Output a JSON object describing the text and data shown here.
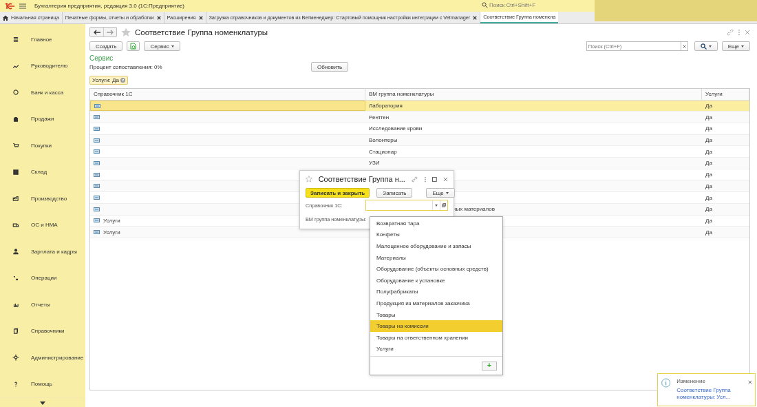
{
  "top_bar": {
    "title": "Бухгалтерия предприятия, редакция 3.0  (1С:Предприятие)",
    "search_placeholder": "Поиск Ctrl+Shift+F"
  },
  "tabs": [
    {
      "label": "Начальная страница",
      "kind": "home",
      "closable": false,
      "selected": false
    },
    {
      "label": "Печатные формы, отчеты и обработки",
      "kind": "tab",
      "closable": true,
      "selected": false
    },
    {
      "label": "Расширения",
      "kind": "tab",
      "closable": true,
      "selected": false
    },
    {
      "label": "Загрузка справочников и документов из Ветменеджер: Стартовый помощник настройки интеграции с Vetmanager",
      "kind": "tab",
      "closable": true,
      "selected": false
    },
    {
      "label": "Соответствие Группа номенкла",
      "kind": "tab",
      "closable": false,
      "selected": true
    }
  ],
  "sidebar": {
    "items": [
      {
        "label": "Главное"
      },
      {
        "label": "Руководителю"
      },
      {
        "label": "Банк и касса"
      },
      {
        "label": "Продажи"
      },
      {
        "label": "Покупки"
      },
      {
        "label": "Склад"
      },
      {
        "label": "Производство"
      },
      {
        "label": "ОС и НМА"
      },
      {
        "label": "Зарплата и кадры"
      },
      {
        "label": "Операции"
      },
      {
        "label": "Отчеты"
      },
      {
        "label": "Справочники"
      },
      {
        "label": "Администрирование"
      },
      {
        "label": "Помощь"
      }
    ]
  },
  "page": {
    "title": "Соответствие Группа номенклатуры",
    "create_button": "Создать",
    "service_button": "Сервис",
    "search_placeholder": "Поиск (Ctrl+F)",
    "more_button": "Еще",
    "section_title": "Сервис",
    "progress_label": "Процент сопоставления:  0%",
    "refresh_button": "Обновить",
    "filter_chip": "Услуги: Да"
  },
  "table": {
    "columns": [
      "Справочник 1С",
      "ВМ группа номенклатуры",
      "Услуги"
    ],
    "rows": [
      {
        "ref_1c": "",
        "vm_group": "Лаборатория",
        "services": "Да",
        "selected": true,
        "kind": "plain"
      },
      {
        "ref_1c": "",
        "vm_group": "Рентген",
        "services": "Да",
        "selected": false,
        "kind": "plain"
      },
      {
        "ref_1c": "",
        "vm_group": "Исследование крови",
        "services": "Да",
        "selected": false,
        "kind": "plain"
      },
      {
        "ref_1c": "",
        "vm_group": "Волонтеры",
        "services": "Да",
        "selected": false,
        "kind": "plain"
      },
      {
        "ref_1c": "",
        "vm_group": "Стационар",
        "services": "Да",
        "selected": false,
        "kind": "plain"
      },
      {
        "ref_1c": "",
        "vm_group": "УЗИ",
        "services": "Да",
        "selected": false,
        "kind": "plain"
      },
      {
        "ref_1c": "",
        "services": "Да",
        "selected": false
      },
      {
        "ref_1c": "",
        "services": "Да",
        "selected": false
      },
      {
        "ref_1c": "",
        "services": "Да",
        "selected": false
      },
      {
        "ref_1c": "",
        "vm_group": "ных материалов",
        "services": "Да",
        "selected": false,
        "kind": "cut"
      },
      {
        "ref_1c": "Услуги",
        "services": "Да",
        "selected": false
      },
      {
        "ref_1c": "Услуги",
        "services": "Да",
        "selected": false
      }
    ]
  },
  "dialog": {
    "title": "Соответствие Группа н...",
    "save_close_button": "Записать и закрыть",
    "save_button": "Записать",
    "more_button": "Еще",
    "fields": [
      {
        "label": "Справочник 1С:"
      },
      {
        "label": "ВМ группа номенклатуры:"
      }
    ]
  },
  "dropdown": {
    "items": [
      {
        "label": "Возвратная тара",
        "selected": false
      },
      {
        "label": "Конфеты",
        "selected": false
      },
      {
        "label": "Малоценное оборудование и запасы",
        "selected": false
      },
      {
        "label": "Материалы",
        "selected": false
      },
      {
        "label": "Оборудование (объекты основных средств)",
        "selected": false
      },
      {
        "label": "Оборудование к установке",
        "selected": false
      },
      {
        "label": "Полуфабрикаты",
        "selected": false
      },
      {
        "label": "Продукция из материалов заказчика",
        "selected": false
      },
      {
        "label": "Товары",
        "selected": false
      },
      {
        "label": "Товары на комиссии",
        "selected": true
      },
      {
        "label": "Товары на ответственном хранении",
        "selected": false
      },
      {
        "label": "Услуги",
        "selected": false
      }
    ],
    "add_button": "+"
  },
  "notification": {
    "title": "Изменение",
    "link": "Соответствие Группа номенклатуры: Усл..."
  }
}
